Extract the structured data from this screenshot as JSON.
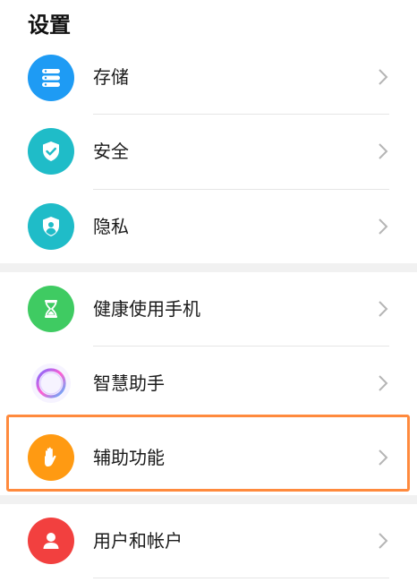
{
  "header": {
    "title": "设置"
  },
  "colors": {
    "storage": "#1e9bf4",
    "security": "#1fbcc8",
    "privacy": "#1fbcc8",
    "digital_balance": "#3fcb62",
    "assistant": "#ffffff",
    "accessibility": "#ff9a12",
    "users": "#f2403f",
    "highlight": "#ff8a3d"
  },
  "groups": [
    {
      "items": [
        {
          "label": "存储",
          "icon": "storage-icon"
        },
        {
          "label": "安全",
          "icon": "shield-check-icon"
        },
        {
          "label": "隐私",
          "icon": "privacy-shield-icon"
        }
      ]
    },
    {
      "items": [
        {
          "label": "健康使用手机",
          "icon": "hourglass-icon"
        },
        {
          "label": "智慧助手",
          "icon": "assistant-ring-icon"
        },
        {
          "label": "辅助功能",
          "icon": "hand-icon",
          "highlighted": true
        }
      ]
    },
    {
      "items": [
        {
          "label": "用户和帐户",
          "icon": "user-icon"
        }
      ]
    }
  ]
}
